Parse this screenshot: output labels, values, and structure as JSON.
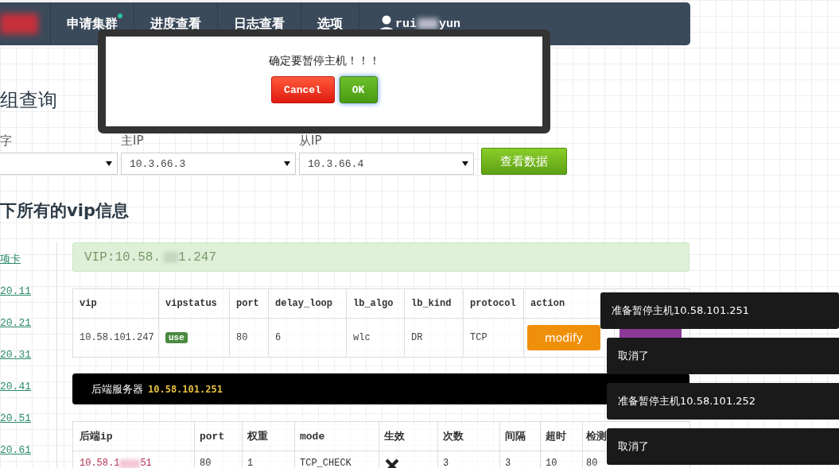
{
  "nav": {
    "items": [
      {
        "label": "申请集群",
        "notify": true
      },
      {
        "label": "进度查看",
        "notify": false
      },
      {
        "label": "日志查看",
        "notify": false
      },
      {
        "label": "选项",
        "notify": false
      }
    ],
    "user": {
      "name_start": "rui",
      "name_end": "yun"
    }
  },
  "query": {
    "title": "组查询",
    "fields": [
      {
        "label": "字"
      },
      {
        "label": "主IP",
        "value": "10.3.66.3"
      },
      {
        "label": "从IP",
        "value": "10.3.66.4"
      }
    ],
    "button": "查看数据"
  },
  "vip_section": {
    "title": "下所有的vip信息",
    "sidebar": [
      "项卡",
      "20.11",
      "20.21",
      "20.31",
      "20.41",
      "20.51",
      "20.61"
    ],
    "alert": {
      "prefix": "VIP:10.58.",
      "suffix": "1.247"
    },
    "vip_table": {
      "columns": [
        "vip",
        "vipstatus",
        "port",
        "delay_loop",
        "lb_algo",
        "lb_kind",
        "protocol",
        "action"
      ],
      "row": {
        "vip": "10.58.101.247",
        "status": "use",
        "port": "80",
        "delay_loop": "6",
        "lb_algo": "wlc",
        "lb_kind": "DR",
        "protocol": "TCP",
        "modify": "modify"
      }
    },
    "backend_bar": {
      "label": "后端服务器",
      "ip": "10.58.101.251"
    },
    "backend_table": {
      "columns": [
        "后端ip",
        "port",
        "权重",
        "mode",
        "生效",
        "次数",
        "间隔",
        "超时",
        "检测"
      ],
      "rows": [
        {
          "ip_start": "10.58.1",
          "ip_end": "51",
          "port": "80",
          "weight": "1",
          "mode": "TCP_CHECK",
          "enabled": false,
          "count": "3",
          "interval": "3",
          "timeout": "10",
          "check_port": "80"
        }
      ]
    }
  },
  "modal": {
    "message": "确定要暂停主机！！！",
    "buttons": [
      {
        "label": "Cancel",
        "kind": "cancel"
      },
      {
        "label": "OK",
        "kind": "ok"
      }
    ]
  },
  "toasts": [
    "准备暂停主机10.58.101.251",
    "取消了",
    "准备暂停主机10.58.101.252",
    "取消了"
  ]
}
